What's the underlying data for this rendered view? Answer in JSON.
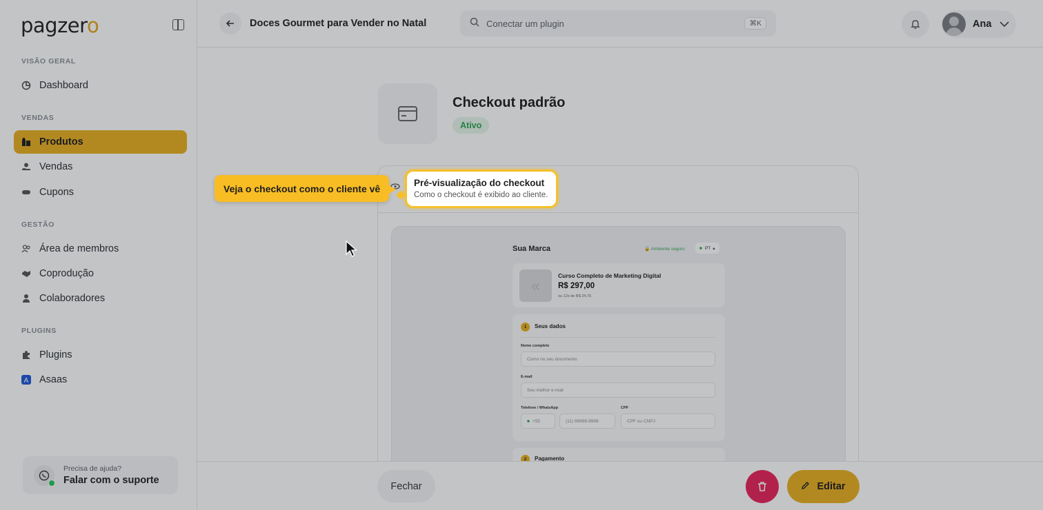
{
  "app": {
    "logo": "pagzer",
    "logo_accent": "o"
  },
  "sidebar": {
    "sections": [
      {
        "label": "VISÃO GERAL"
      },
      {
        "label": "VENDAS"
      },
      {
        "label": "GESTÃO"
      },
      {
        "label": "PLUGINS"
      }
    ],
    "items": [
      {
        "label": "Dashboard",
        "icon": "chart-pie-icon"
      },
      {
        "label": "Produtos",
        "icon": "box-icon",
        "active": true
      },
      {
        "label": "Vendas",
        "icon": "hand-money-icon"
      },
      {
        "label": "Cupons",
        "icon": "ticket-icon"
      },
      {
        "label": "Área de membros",
        "icon": "users-icon"
      },
      {
        "label": "Coprodução",
        "icon": "handshake-icon"
      },
      {
        "label": "Colaboradores",
        "icon": "person-icon"
      },
      {
        "label": "Plugins",
        "icon": "puzzle-icon"
      },
      {
        "label": "Asaas",
        "icon": "asaas-icon"
      }
    ],
    "support": {
      "small": "Precisa de ajuda?",
      "big": "Falar com o suporte"
    }
  },
  "header": {
    "title": "Doces Gourmet para Vender no Natal",
    "search_placeholder": "Conectar um plugin",
    "shortcut": "⌘K",
    "user_name": "Ana"
  },
  "main": {
    "checkout_title": "Checkout padrão",
    "status": "Ativo",
    "preview_title": "Pré-visualização do checkout",
    "preview_subtitle": "Como o checkout é exibido ao cliente."
  },
  "mini_checkout": {
    "brand": "Sua Marca",
    "secure": "Ambiente seguro",
    "lang": "PT",
    "product_name": "Curso Completo de Marketing Digital",
    "price": "R$ 297,00",
    "installments": "ou 12x de R$ 24,75",
    "section_title": "Seus dados",
    "step": "1",
    "name_label": "Nome completo",
    "name_placeholder": "Como no seu documento",
    "email_label": "E-mail",
    "email_placeholder": "Seu melhor e-mail",
    "phone_label": "Telefone / WhatsApp",
    "phone_code": "+55",
    "phone_placeholder": "(11) 99999-9999",
    "cpf_label": "CPF",
    "cpf_placeholder": "CPF ou CNPJ",
    "payment_title": "Pagamento",
    "payment_step": "2"
  },
  "footer": {
    "close_label": "Fechar",
    "edit_label": "Editar"
  },
  "tooltip": {
    "text": "Veja o checkout como o cliente vê"
  },
  "colors": {
    "accent": "#e8b021",
    "danger": "#e8245b",
    "success": "#2aa44f"
  }
}
